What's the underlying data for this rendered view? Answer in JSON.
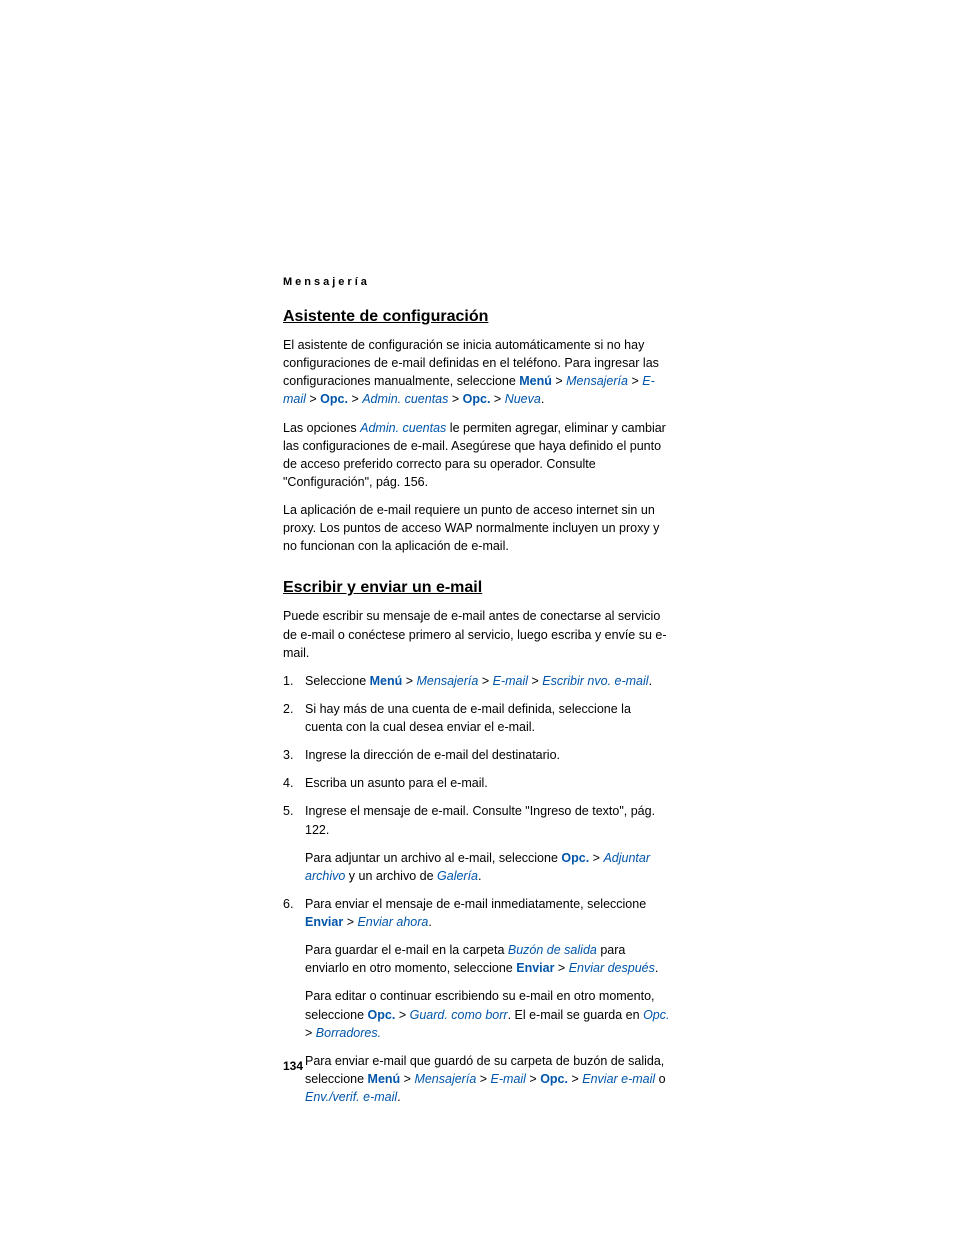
{
  "header": "Mensajería",
  "section1": {
    "heading": "Asistente de configuración",
    "p1a": "El asistente de configuración se inicia automáticamente si no hay configuraciones de e-mail definidas en el teléfono. Para ingresar las configuraciones manualmente, seleccione ",
    "menu": "Menú",
    "mensajeria": "Mensajería",
    "email": "E-mail",
    "opc": "Opc.",
    "admin": "Admin. cuentas",
    "nueva": "Nueva",
    "p2a": "Las opciones ",
    "p2b": " le permiten agregar, eliminar y cambiar las configuraciones de e-mail. Asegúrese que haya definido el punto de acceso preferido correcto para su operador. Consulte \"Configuración\", pág. 156.",
    "p3": "La aplicación de e-mail requiere un punto de acceso internet sin un proxy. Los puntos de acceso WAP normalmente incluyen un proxy y no funcionan con la aplicación de e-mail."
  },
  "section2": {
    "heading": "Escribir y enviar un e-mail",
    "intro": "Puede escribir su mensaje de e-mail antes de conectarse al servicio de e-mail o conéctese primero al servicio, luego escriba y envíe su e-mail.",
    "li1a": "Seleccione ",
    "escribir": "Escribir nvo. e-mail",
    "li2": "Si hay más de una cuenta de e-mail definida, seleccione la cuenta con la cual desea enviar el e-mail.",
    "li3": "Ingrese la dirección de e-mail del destinatario.",
    "li4": "Escriba un asunto para el e-mail.",
    "li5a": "Ingrese el mensaje de e-mail. Consulte \"Ingreso de texto\", pág. 122.",
    "li5b1": "Para adjuntar un archivo al e-mail, seleccione ",
    "adjuntar": "Adjuntar archivo",
    "li5b2": " y un archivo de ",
    "galeria": "Galería",
    "li6a": "Para enviar el mensaje de e-mail inmediatamente, seleccione ",
    "enviar": "Enviar",
    "enviarahora": "Enviar ahora",
    "li6b1": "Para guardar el e-mail en la carpeta ",
    "buzon": "Buzón de salida",
    "li6b2": " para enviarlo en otro momento, seleccione ",
    "enviardespues": "Enviar después",
    "li6c1": "Para editar o continuar escribiendo su e-mail en otro momento, seleccione ",
    "guardborr": "Guard. como borr",
    "li6c2": ". El e-mail se guarda en ",
    "borradores": "Borradores.",
    "li6d1": "Para enviar e-mail que guardó de su carpeta de buzón de salida, seleccione ",
    "enviaremail": "Enviar e-mail",
    "o": " o ",
    "envverif": "Env./verif. e-mail"
  },
  "pageNumber": "134"
}
